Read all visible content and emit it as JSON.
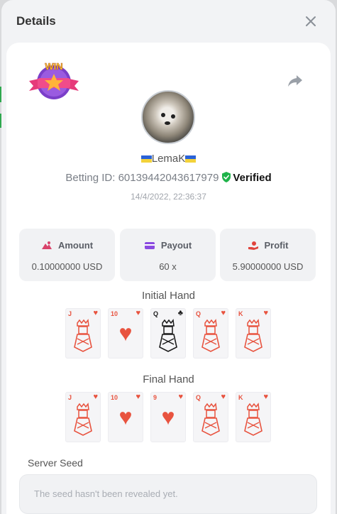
{
  "modal": {
    "title": "Details"
  },
  "player": {
    "name": "LemaK",
    "betting_id_label": "Betting ID:",
    "betting_id": "601394420436179 79",
    "verified_label": "Verified",
    "datetime": "14/4/2022, 22:36:37"
  },
  "stats": [
    {
      "label": "Amount",
      "value": "0.10000000 USD",
      "icon": "amount-icon",
      "color": "#d9436b"
    },
    {
      "label": "Payout",
      "value": "60 x",
      "icon": "payout-card-icon",
      "color": "#8b4be0"
    },
    {
      "label": "Profit",
      "value": "5.90000000 USD",
      "icon": "profit-hand-icon",
      "color": "#e0443d"
    }
  ],
  "initial_hand": {
    "title": "Initial Hand",
    "cards": [
      {
        "rank": "J",
        "suit": "♥",
        "color": "red"
      },
      {
        "rank": "10",
        "suit": "♥",
        "color": "red"
      },
      {
        "rank": "Q",
        "suit": "♣",
        "color": "black"
      },
      {
        "rank": "Q",
        "suit": "♥",
        "color": "red"
      },
      {
        "rank": "K",
        "suit": "♥",
        "color": "red"
      }
    ]
  },
  "final_hand": {
    "title": "Final Hand",
    "cards": [
      {
        "rank": "J",
        "suit": "♥",
        "color": "red"
      },
      {
        "rank": "10",
        "suit": "♥",
        "color": "red"
      },
      {
        "rank": "9",
        "suit": "♥",
        "color": "red"
      },
      {
        "rank": "Q",
        "suit": "♥",
        "color": "red"
      },
      {
        "rank": "K",
        "suit": "♥",
        "color": "red"
      }
    ]
  },
  "server_seed": {
    "label": "Server Seed",
    "placeholder": "The seed hasn't been revealed yet."
  },
  "badge": {
    "text": "WIN"
  },
  "colors": {
    "verified": "#1fb34a",
    "accent_red": "#e8533f"
  }
}
